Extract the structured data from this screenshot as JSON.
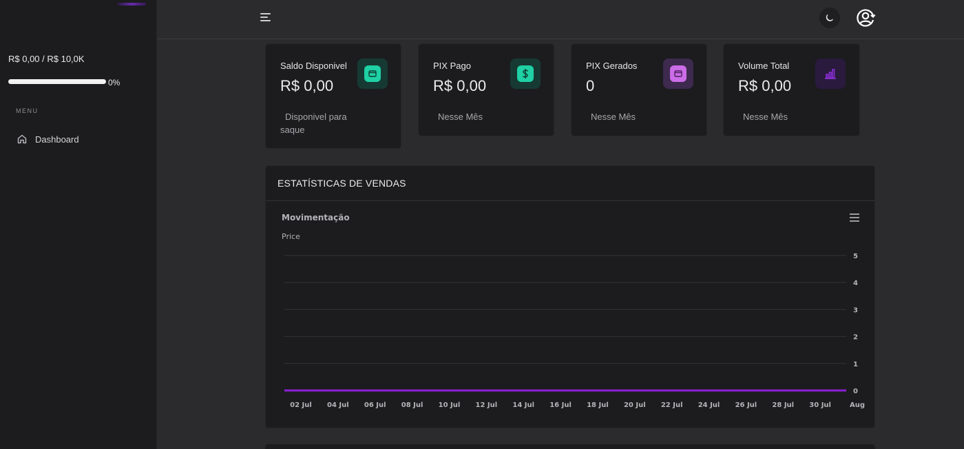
{
  "sidebar": {
    "balance": "R$ 0,00 / R$ 10,0K",
    "progress": {
      "percent_label": "0%",
      "value": 0
    },
    "menu_label": "MENU",
    "items": [
      {
        "label": "Dashboard",
        "icon": "home-icon"
      }
    ]
  },
  "topbar": {
    "menu_icon": "hamburger-icon",
    "theme_icon": "moon-icon",
    "user_icon": "user-circle-icon"
  },
  "cards": [
    {
      "title": "Saldo Disponivel",
      "value": "R$ 0,00",
      "subtitle": "Disponivel para saque",
      "icon": "wallet-icon",
      "icon_bg": "#163a33",
      "icon_fg": "#1fd1a5"
    },
    {
      "title": "PIX Pago",
      "value": "R$ 0,00",
      "subtitle": "Nesse Mês",
      "icon": "dollar-icon",
      "icon_bg": "#163a33",
      "icon_fg": "#1fd1a5"
    },
    {
      "title": "PIX Gerados",
      "value": "0",
      "subtitle": "Nesse Mês",
      "icon": "wallet-icon",
      "icon_bg": "#3d2a4e",
      "icon_fg": "#cc6de8"
    },
    {
      "title": "Volume Total",
      "value": "R$ 0,00",
      "subtitle": "Nesse Mês",
      "icon": "bar-chart-icon",
      "icon_bg": "#2a1a3e",
      "icon_fg": "#8b2fd6"
    }
  ],
  "stats": {
    "title": "ESTATÍSTICAS DE VENDAS"
  },
  "chart_data": {
    "type": "line",
    "title": "Movimentação",
    "ylabel": "Price",
    "ylim": [
      0,
      5
    ],
    "yticks": [
      "0",
      "1",
      "2",
      "3",
      "4",
      "5"
    ],
    "xticks": [
      "02 Jul",
      "04 Jul",
      "06 Jul",
      "08 Jul",
      "10 Jul",
      "12 Jul",
      "14 Jul",
      "16 Jul",
      "18 Jul",
      "20 Jul",
      "22 Jul",
      "24 Jul",
      "26 Jul",
      "28 Jul",
      "30 Jul",
      "Aug"
    ],
    "series": [
      {
        "values": [
          0,
          0,
          0,
          0,
          0,
          0,
          0,
          0,
          0,
          0,
          0,
          0,
          0,
          0,
          0,
          0
        ]
      }
    ],
    "line_color": "#8b1fd6",
    "grid": true,
    "y_axis_side": "right"
  }
}
